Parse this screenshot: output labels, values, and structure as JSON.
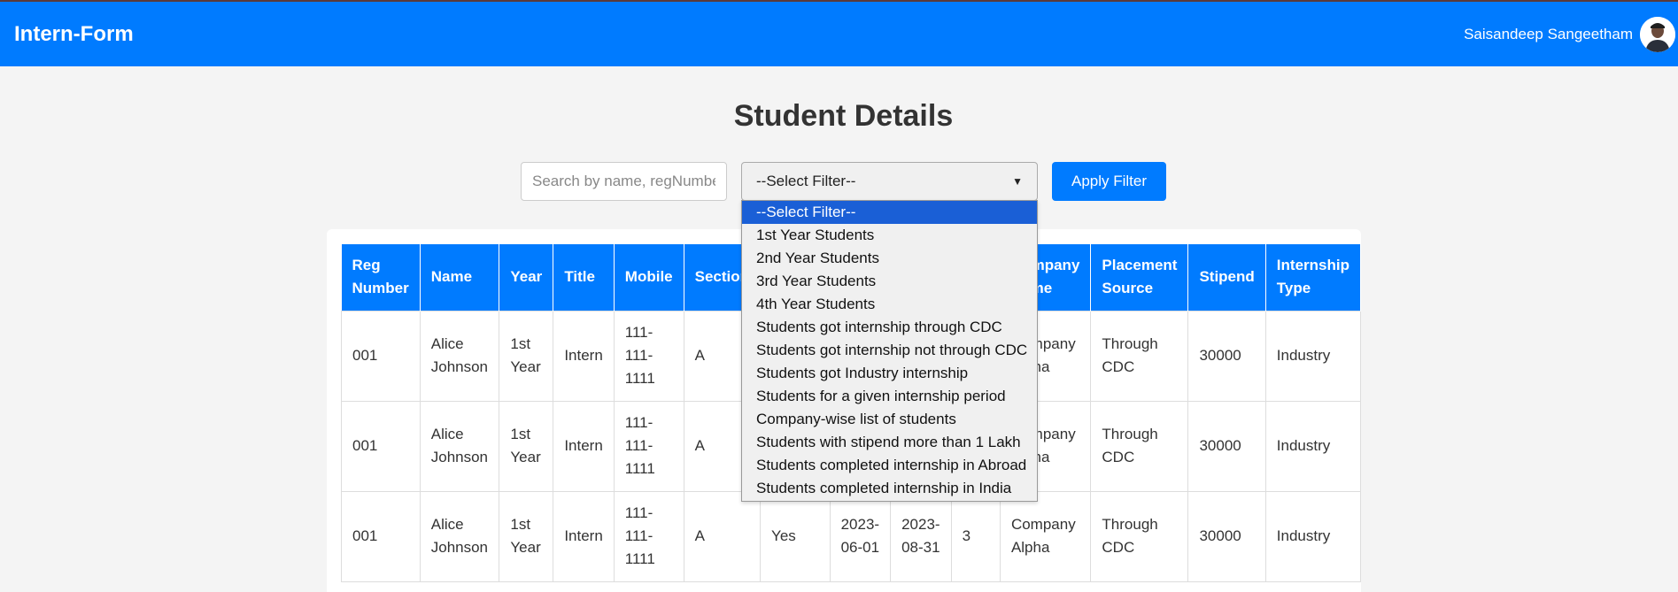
{
  "navbar": {
    "brand": "Intern-Form",
    "user_name": "Saisandeep Sangeetham",
    "avatar_icon": "user-avatar",
    "color": "#007bff"
  },
  "page": {
    "title": "Student Details"
  },
  "filters": {
    "search_placeholder": "Search by name, regNumber...",
    "selected": "--Select Filter--",
    "apply_label": "Apply Filter",
    "options": [
      "--Select Filter--",
      "1st Year Students",
      "2nd Year Students",
      "3rd Year Students",
      "4th Year Students",
      "Students got internship through CDC",
      "Students got internship not through CDC",
      "Students got Industry internship",
      "Students for a given internship period",
      "Company-wise list of students",
      "Students with stipend more than 1 Lakh",
      "Students completed internship in Abroad",
      "Students completed internship in India"
    ]
  },
  "table": {
    "headers": [
      "Reg\nNumber",
      "Name",
      "Year",
      "Title",
      "Mobile",
      "Section",
      "",
      "",
      "",
      "",
      "Company\nName",
      "Placement\nSource",
      "Stipend",
      "Internship\nType"
    ],
    "rows": [
      [
        "001",
        "Alice\nJohnson",
        "1st\nYear",
        "Intern",
        "111-\n111-\n1111",
        "A",
        "",
        "",
        "",
        "",
        "Company\nAlpha",
        "Through\nCDC",
        "30000",
        "Industry"
      ],
      [
        "001",
        "Alice\nJohnson",
        "1st\nYear",
        "Intern",
        "111-\n111-\n1111",
        "A",
        "",
        "",
        "",
        "",
        "Company\nAlpha",
        "Through\nCDC",
        "30000",
        "Industry"
      ],
      [
        "001",
        "Alice\nJohnson",
        "1st\nYear",
        "Intern",
        "111-\n111-\n1111",
        "A",
        "Yes",
        "2023-\n06-01",
        "2023-\n08-31",
        "3",
        "Company\nAlpha",
        "Through\nCDC",
        "30000",
        "Industry"
      ]
    ]
  }
}
